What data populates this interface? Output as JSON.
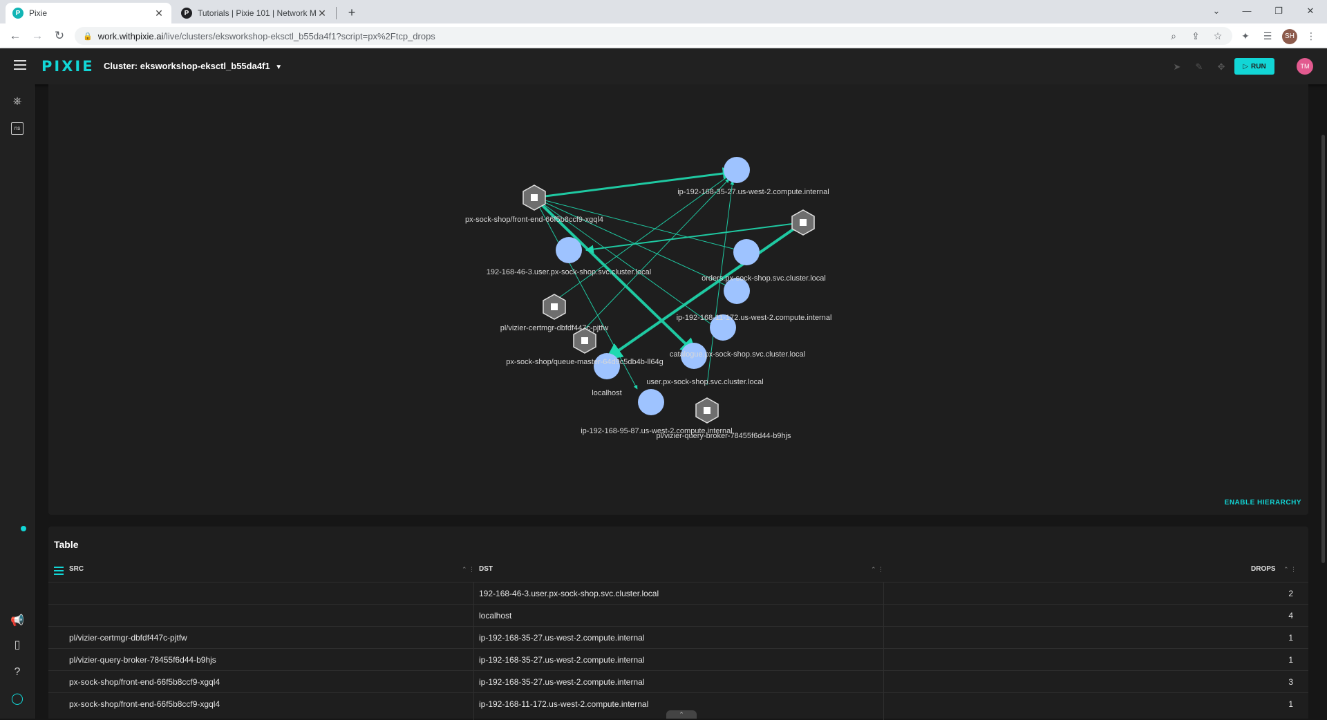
{
  "browser": {
    "tabs": [
      {
        "title": "Pixie",
        "active": true
      },
      {
        "title": "Tutorials | Pixie 101 | Network M",
        "active": false
      }
    ],
    "url_host": "work.withpixie.ai",
    "url_path": "/live/clusters/eksworkshop-eksctl_b55da4f1?script=px%2Ftcp_drops",
    "profile_initials": "SH"
  },
  "app": {
    "logo": "PIXIE",
    "cluster_label": "Cluster:",
    "cluster_name": "eksworkshop-eksctl_b55da4f1",
    "run_label": "RUN",
    "avatar_initials": "TM",
    "accent_color": "#12d6d6"
  },
  "rail": {
    "ns_label": "ns"
  },
  "graph": {
    "enable_hierarchy": "ENABLE HIERARCHY",
    "nodes": [
      {
        "id": "n1",
        "label": "px-sock-shop/front-end-66f5b8ccf9-xgql4",
        "kind": "pod"
      },
      {
        "id": "n2",
        "label": "ip-192-168-35-27.us-west-2.compute.internal",
        "kind": "service"
      },
      {
        "id": "n3",
        "label": "pl/vizier-query-broker-78455f6d44-b9hjs",
        "kind": "pod"
      },
      {
        "id": "n4",
        "label": "192-168-46-3.user.px-sock-shop.svc.cluster.local",
        "kind": "service"
      },
      {
        "id": "n5",
        "label": "orders.px-sock-shop.svc.cluster.local",
        "kind": "service"
      },
      {
        "id": "n6",
        "label": "ip-192-168-11-172.us-west-2.compute.internal",
        "kind": "service"
      },
      {
        "id": "n7",
        "label": "pl/vizier-certmgr-dbfdf447c-pjtfw",
        "kind": "pod"
      },
      {
        "id": "n8",
        "label": "px-sock-shop/queue-master-64d9c5db4b-ll64g",
        "kind": "pod"
      },
      {
        "id": "n9",
        "label": "catalogue.px-sock-shop.svc.cluster.local",
        "kind": "service"
      },
      {
        "id": "n10",
        "label": "localhost",
        "kind": "service"
      },
      {
        "id": "n11",
        "label": "user.px-sock-shop.svc.cluster.local",
        "kind": "service"
      },
      {
        "id": "n12",
        "label": "ip-192-168-95-87.us-west-2.compute.internal",
        "kind": "service"
      },
      {
        "id": "n13",
        "label": "pl/vizier-query-broker-78455f6d44-b9hjs",
        "kind": "pod"
      }
    ]
  },
  "table": {
    "title": "Table",
    "columns": [
      "SRC",
      "DST",
      "DROPS"
    ],
    "rows": [
      {
        "src": "",
        "dst": "192-168-46-3.user.px-sock-shop.svc.cluster.local",
        "drops": "2"
      },
      {
        "src": "",
        "dst": "localhost",
        "drops": "4"
      },
      {
        "src": "pl/vizier-certmgr-dbfdf447c-pjtfw",
        "dst": "ip-192-168-35-27.us-west-2.compute.internal",
        "drops": "1"
      },
      {
        "src": "pl/vizier-query-broker-78455f6d44-b9hjs",
        "dst": "ip-192-168-35-27.us-west-2.compute.internal",
        "drops": "1"
      },
      {
        "src": "px-sock-shop/front-end-66f5b8ccf9-xgql4",
        "dst": "ip-192-168-35-27.us-west-2.compute.internal",
        "drops": "3"
      },
      {
        "src": "px-sock-shop/front-end-66f5b8ccf9-xgql4",
        "dst": "ip-192-168-11-172.us-west-2.compute.internal",
        "drops": "1"
      }
    ]
  }
}
